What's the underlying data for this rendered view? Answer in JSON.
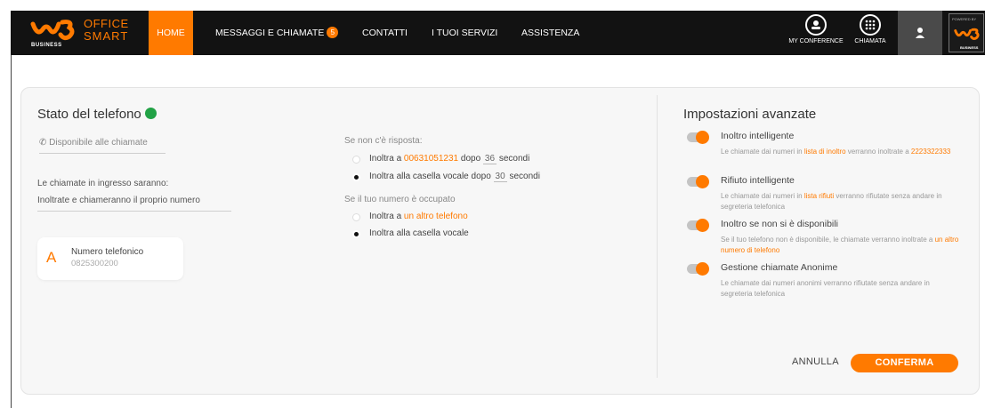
{
  "brand": {
    "business": "BUSINESS",
    "office": "OFFICE",
    "smart": "SMART",
    "powered_by": "POWERED BY",
    "powered_business": "BUSINESS"
  },
  "nav": {
    "home": "HOME",
    "messaggi": "MESSAGGI E CHIAMATE",
    "messaggi_badge": "5",
    "contatti": "CONTATTI",
    "servizi": "I TUOI SERVIZI",
    "assistenza": "ASSISTENZA"
  },
  "actions": {
    "conference": "MY CONFERENCE",
    "call": "CHIAMATA"
  },
  "colors": {
    "accent": "#ff7a00",
    "status": "#22a246",
    "topbar": "#121212"
  },
  "phone_status": {
    "title": "Stato del telefono",
    "availability": "Disponibile alle chiamate",
    "incoming_label": "Le chiamate in ingresso saranno:",
    "incoming_value": "Inoltrate e chiameranno il proprio numero",
    "card_letter": "A",
    "card_label": "Numero telefonico",
    "card_number": "0825300200"
  },
  "no_answer": {
    "label": "Se non c'è risposta:",
    "opt1_prefix": "Inoltra a",
    "opt1_number": "00631051231",
    "opt1_after": "dopo",
    "opt1_seconds": "36",
    "opt1_unit": "secondi",
    "opt2_prefix": "Inoltra alla casella vocale dopo",
    "opt2_seconds": "30",
    "opt2_unit": "secondi",
    "selected": 2
  },
  "busy": {
    "label": "Se il tuo numero è occupato",
    "opt1_prefix": "Inoltra a",
    "opt1_link": "un altro telefono",
    "opt2": "Inoltra alla casella vocale",
    "selected": 2
  },
  "advanced": {
    "title": "Impostazioni avanzate",
    "items": [
      {
        "title": "Inoltro intelligente",
        "desc_a": "Le chiamate dai numeri in ",
        "link": "lista di inoltro",
        "desc_b": " verranno inoltrate a ",
        "link2": "2223322333",
        "enabled": true
      },
      {
        "title": "Rifiuto intelligente",
        "desc_a": "Le chiamate dai numeri in ",
        "link": "lista rifiuti",
        "desc_b": " verranno rifiutate senza andare in segreteria telefonica",
        "enabled": true
      },
      {
        "title": "Inoltro se non si è disponibili",
        "desc_a": "Se il tuo telefono non è disponibile, le chiamate verranno inoltrate a ",
        "link": "un altro numero di telefono",
        "enabled": true
      },
      {
        "title": "Gestione chiamate Anonime",
        "desc_a": "Le chiamate dai numeri anonimi verranno rifiutate senza andare in segreteria telefonica",
        "enabled": true
      }
    ]
  },
  "buttons": {
    "cancel": "ANNULLA",
    "confirm": "CONFERMA"
  }
}
